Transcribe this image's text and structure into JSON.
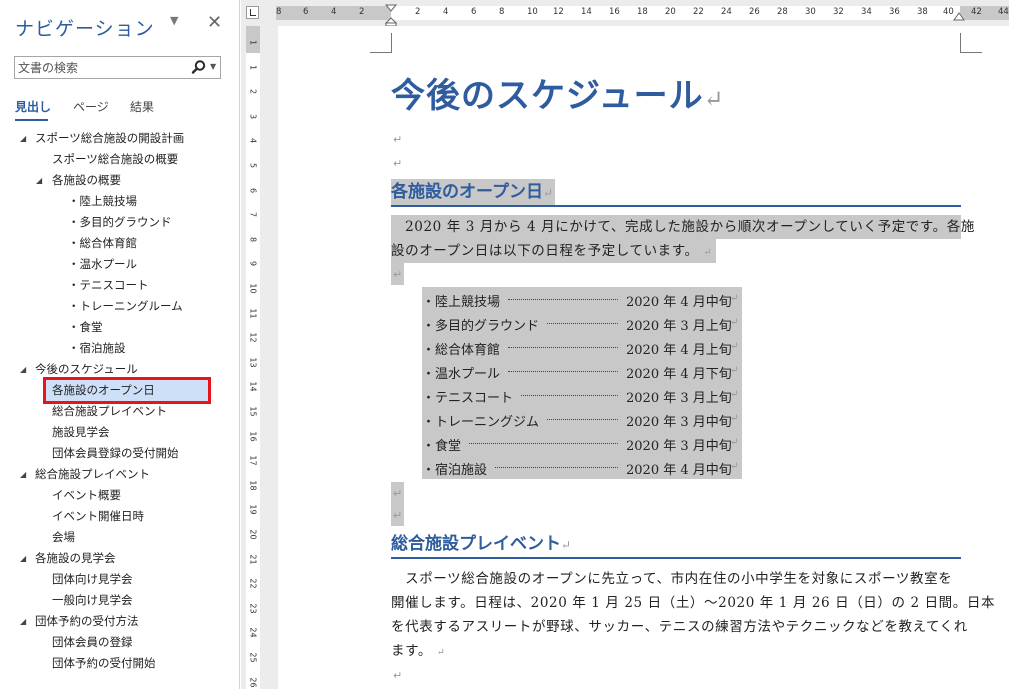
{
  "nav": {
    "title": "ナビゲーション",
    "menu_glyph": "▼",
    "close_glyph": "✕",
    "search_placeholder": "文書の検索",
    "search_dropdown_glyph": "▼",
    "tabs": [
      "見出し",
      "ページ",
      "結果"
    ],
    "active_tab": "見出し",
    "tree": [
      {
        "label": "スポーツ総合施設の開設計画",
        "level": 1,
        "expanded": true
      },
      {
        "label": "スポーツ総合施設の概要",
        "level": 2
      },
      {
        "label": "各施設の概要",
        "level": 2,
        "expanded": true
      },
      {
        "label": "・陸上競技場",
        "level": 3
      },
      {
        "label": "・多目的グラウンド",
        "level": 3
      },
      {
        "label": "・総合体育館",
        "level": 3
      },
      {
        "label": "・温水プール",
        "level": 3
      },
      {
        "label": "・テニスコート",
        "level": 3
      },
      {
        "label": "・トレーニングルーム",
        "level": 3
      },
      {
        "label": "・食堂",
        "level": 3
      },
      {
        "label": "・宿泊施設",
        "level": 3
      },
      {
        "label": "今後のスケジュール",
        "level": 1,
        "expanded": true
      },
      {
        "label": "各施設のオープン日",
        "level": 2,
        "selected": true
      },
      {
        "label": "総合施設プレイベント",
        "level": 2
      },
      {
        "label": "施設見学会",
        "level": 2
      },
      {
        "label": "団体会員登録の受付開始",
        "level": 2
      },
      {
        "label": "総合施設プレイベント",
        "level": 1,
        "expanded": true
      },
      {
        "label": "イベント概要",
        "level": 2
      },
      {
        "label": "イベント開催日時",
        "level": 2
      },
      {
        "label": "会場",
        "level": 2
      },
      {
        "label": "各施設の見学会",
        "level": 1,
        "expanded": true
      },
      {
        "label": "団体向け見学会",
        "level": 2
      },
      {
        "label": "一般向け見学会",
        "level": 2
      },
      {
        "label": "団体予約の受付方法",
        "level": 1,
        "expanded": true
      },
      {
        "label": "団体会員の登録",
        "level": 2
      },
      {
        "label": "団体予約の受付開始",
        "level": 2
      }
    ],
    "expanded_glyph": "◢",
    "selection_color": "#cde0f7",
    "selection_border": "#e8141b"
  },
  "ruler": {
    "horizontal_labels": [
      "8",
      "6",
      "4",
      "2",
      "2",
      "4",
      "6",
      "8",
      "10",
      "12",
      "14",
      "16",
      "18",
      "20",
      "22",
      "24",
      "26",
      "28",
      "30",
      "32",
      "34",
      "36",
      "38",
      "40",
      "42",
      "44"
    ],
    "vertical_labels": [
      "1",
      "1",
      "2",
      "3",
      "4",
      "5",
      "6",
      "7",
      "8",
      "9",
      "10",
      "11",
      "12",
      "13",
      "14",
      "15",
      "16",
      "17",
      "18",
      "19",
      "20",
      "21",
      "22",
      "23",
      "24",
      "25",
      "26"
    ]
  },
  "document": {
    "title": "今後のスケジュール",
    "return_glyph": "↵",
    "section1": {
      "heading": "各施設のオープン日",
      "para_line1": "　2020 年 3 月から 4 月にかけて、完成した施設から順次オープンしていく予定です。各施",
      "para_line2": "設のオープン日は以下の日程を予定しています。",
      "schedule": [
        {
          "name": "・陸上競技場",
          "date": "2020 年 4 月中旬"
        },
        {
          "name": "・多目的グラウンド",
          "date": "2020 年 3 月上旬"
        },
        {
          "name": "・総合体育館",
          "date": "2020 年 4 月上旬"
        },
        {
          "name": "・温水プール",
          "date": "2020 年 4 月下旬"
        },
        {
          "name": "・テニスコート",
          "date": "2020 年 3 月上旬"
        },
        {
          "name": "・トレーニングジム",
          "date": "2020 年 3 月中旬"
        },
        {
          "name": "・食堂",
          "date": "2020 年 3 月中旬"
        },
        {
          "name": "・宿泊施設",
          "date": "2020 年 4 月中旬"
        }
      ]
    },
    "section2": {
      "heading": "総合施設プレイベント",
      "lines": [
        "　スポーツ総合施設のオープンに先立って、市内在住の小中学生を対象にスポーツ教室を",
        "開催します。日程は、2020 年 1 月 25 日（土）～2020 年 1 月 26 日（日）の 2 日間。日本",
        "を代表するアスリートが野球、サッカー、テニスの練習方法やテクニックなどを教えてくれ",
        "ます。"
      ]
    },
    "heading_color": "#2e5c9e",
    "highlight_color": "#c8c8c8"
  }
}
